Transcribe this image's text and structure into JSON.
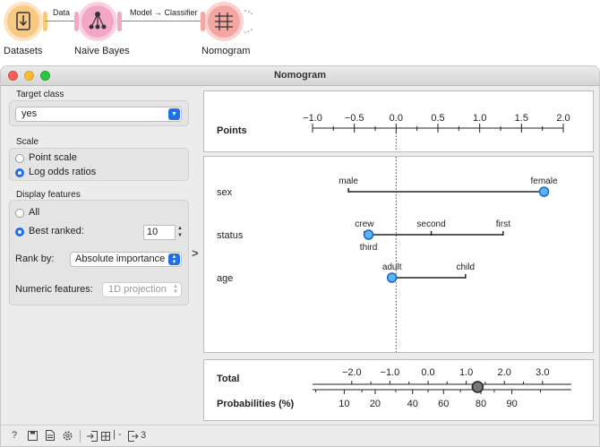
{
  "workflow": {
    "nodes": [
      {
        "label": "Datasets"
      },
      {
        "label": "Naive Bayes"
      },
      {
        "label": "Nomogram"
      }
    ],
    "edges": [
      {
        "label": "Data"
      },
      {
        "label": "Model → Classifier"
      }
    ]
  },
  "window": {
    "title": "Nomogram"
  },
  "target_class": {
    "title": "Target class",
    "value": "yes"
  },
  "scale": {
    "title": "Scale",
    "options": [
      "Point scale",
      "Log odds ratios"
    ],
    "selected": 1
  },
  "display_features": {
    "title": "Display features",
    "all_label": "All",
    "best_label": "Best ranked:",
    "best_value": "10",
    "rank_by_label": "Rank by:",
    "rank_by_value": "Absolute importance",
    "numeric_label": "Numeric features:",
    "numeric_value": "1D projection"
  },
  "collapse_arrow": ">",
  "nomogram": {
    "points_label": "Points",
    "points_ticks": [
      "−1.0",
      "−0.5",
      "0.0",
      "0.5",
      "1.0",
      "1.5",
      "2.0"
    ],
    "points_range": [
      -1.0,
      2.0
    ],
    "features": [
      {
        "name": "sex",
        "values": [
          {
            "label": "male",
            "x": -0.57
          },
          {
            "label": "female",
            "x": 1.77
          }
        ],
        "selected": 1
      },
      {
        "name": "status",
        "values": [
          {
            "label": "crew",
            "x": -0.38
          },
          {
            "label": "third",
            "x": -0.33
          },
          {
            "label": "second",
            "x": 0.42
          },
          {
            "label": "first",
            "x": 1.28
          }
        ],
        "selected": 1
      },
      {
        "name": "age",
        "values": [
          {
            "label": "adult",
            "x": -0.05
          },
          {
            "label": "child",
            "x": 0.83
          }
        ],
        "selected": 0
      }
    ],
    "total_label": "Total",
    "total_ticks": [
      "−2.0",
      "−1.0",
      "0.0",
      "1.0",
      "2.0",
      "3.0"
    ],
    "total_value": 1.3,
    "prob_label": "Probabilities (%)",
    "prob_ticks": [
      "10",
      "20",
      "40",
      "60",
      "80",
      "90"
    ]
  },
  "statusbar": {
    "count": "3"
  },
  "colors": {
    "accent": "#1f6fe5",
    "point_fill": "#5ab4f5",
    "point_stroke": "#1a65c9"
  }
}
